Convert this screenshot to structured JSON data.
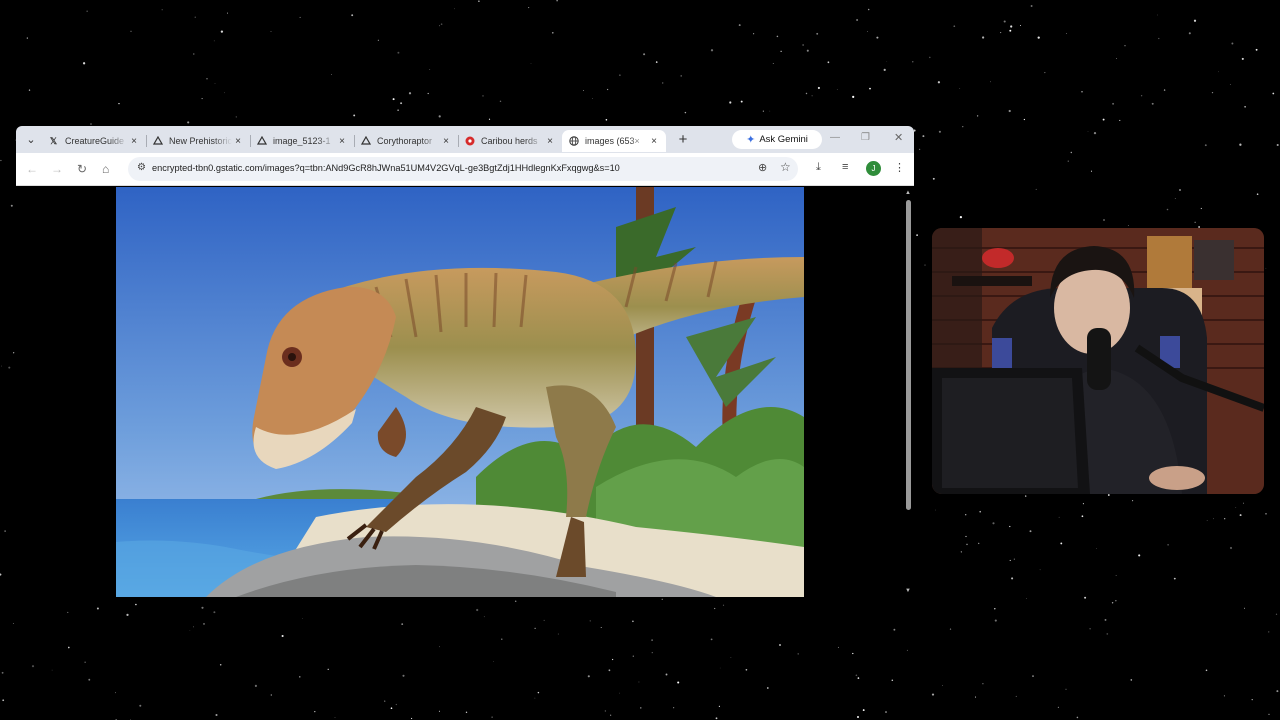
{
  "browser": {
    "tab_list_icon": "chevron-down-icon",
    "tabs": [
      {
        "title": "CreatureGuide",
        "icon": "x-logo-icon",
        "active": false
      },
      {
        "title": "New Prehistoric",
        "icon": "artstation-icon",
        "active": false
      },
      {
        "title": "image_5123-1",
        "icon": "artstation-icon",
        "active": false
      },
      {
        "title": "Corythoraptor",
        "icon": "artstation-icon",
        "active": false
      },
      {
        "title": "Caribou herds",
        "icon": "cbc-icon",
        "active": false
      },
      {
        "title": "images (653×",
        "icon": "globe-icon",
        "active": true
      }
    ],
    "close_glyph": "×",
    "new_tab_glyph": "+",
    "gemini_label": "Ask Gemini",
    "url": "encrypted-tbn0.gstatic.com/images?q=tbn:ANd9GcR8hJWna51UM4V2GVqL-ge3BgtZdj1HHdlegnKxFxqgwg&s=10",
    "profile_initial": "J",
    "page_image": "dinosaur-illustration-on-beach"
  },
  "webcam": {
    "content": "streamer-webcam-feed"
  },
  "colors": {
    "tabstrip": "#dfe3eb",
    "omnibox": "#eff2f7",
    "profile": "#2f8d3a",
    "background": "#000000"
  }
}
